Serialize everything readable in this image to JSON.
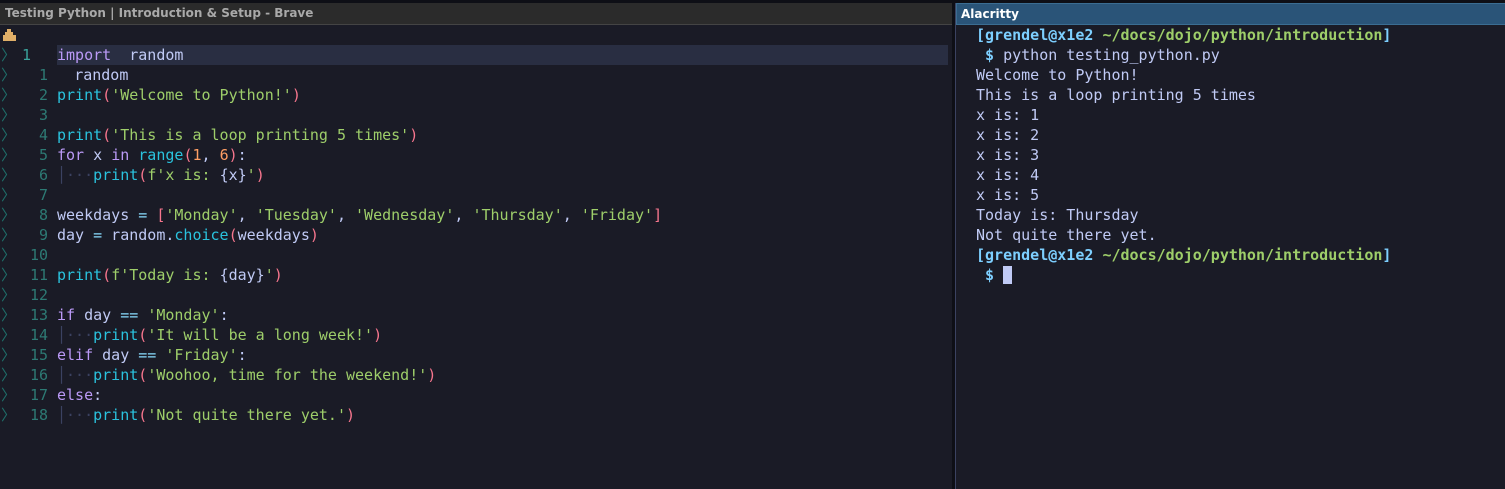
{
  "browser": {
    "title": "Testing Python | Introduction & Setup - Brave"
  },
  "editor": {
    "header": "random",
    "lines": [
      {
        "num": "1",
        "current": true,
        "tokens": [
          [
            "kw",
            "import"
          ],
          [
            "",
            "  "
          ],
          [
            "",
            "random"
          ]
        ]
      },
      {
        "num": "1",
        "tokens": []
      },
      {
        "num": "2",
        "tokens": [
          [
            "fn",
            "print"
          ],
          [
            "par",
            "("
          ],
          [
            "str",
            "'Welcome to Python!'"
          ],
          [
            "par",
            ")"
          ]
        ]
      },
      {
        "num": "3",
        "tokens": []
      },
      {
        "num": "4",
        "tokens": [
          [
            "fn",
            "print"
          ],
          [
            "par",
            "("
          ],
          [
            "str",
            "'This is a loop printing 5 times'"
          ],
          [
            "par",
            ")"
          ]
        ]
      },
      {
        "num": "5",
        "tokens": [
          [
            "kw",
            "for"
          ],
          [
            "",
            " x "
          ],
          [
            "kw",
            "in"
          ],
          [
            "",
            " "
          ],
          [
            "fn",
            "range"
          ],
          [
            "par",
            "("
          ],
          [
            "num",
            "1"
          ],
          [
            "",
            ", "
          ],
          [
            "num",
            "6"
          ],
          [
            "par",
            ")"
          ],
          [
            "",
            ":"
          ]
        ]
      },
      {
        "num": "6",
        "tokens": [
          [
            "guide",
            "│···"
          ],
          [
            "fn",
            "print"
          ],
          [
            "par",
            "("
          ],
          [
            "str",
            "f'x is: "
          ],
          [
            "",
            "{x}"
          ],
          [
            "str",
            "'"
          ],
          [
            "par",
            ")"
          ]
        ]
      },
      {
        "num": "7",
        "tokens": []
      },
      {
        "num": "8",
        "tokens": [
          [
            "",
            "weekdays "
          ],
          [
            "op",
            "="
          ],
          [
            "",
            " "
          ],
          [
            "par",
            "["
          ],
          [
            "str",
            "'Monday'"
          ],
          [
            "",
            ", "
          ],
          [
            "str",
            "'Tuesday'"
          ],
          [
            "",
            ", "
          ],
          [
            "str",
            "'Wednesday'"
          ],
          [
            "",
            ", "
          ],
          [
            "str",
            "'Thursday'"
          ],
          [
            "",
            ", "
          ],
          [
            "str",
            "'Friday'"
          ],
          [
            "par",
            "]"
          ]
        ]
      },
      {
        "num": "9",
        "tokens": [
          [
            "",
            "day "
          ],
          [
            "op",
            "="
          ],
          [
            "",
            " random."
          ],
          [
            "fn",
            "choice"
          ],
          [
            "par",
            "("
          ],
          [
            "",
            "weekdays"
          ],
          [
            "par",
            ")"
          ]
        ]
      },
      {
        "num": "10",
        "tokens": []
      },
      {
        "num": "11",
        "tokens": [
          [
            "fn",
            "print"
          ],
          [
            "par",
            "("
          ],
          [
            "str",
            "f'Today is: "
          ],
          [
            "",
            "{day}"
          ],
          [
            "str",
            "'"
          ],
          [
            "par",
            ")"
          ]
        ]
      },
      {
        "num": "12",
        "tokens": []
      },
      {
        "num": "13",
        "tokens": [
          [
            "kw",
            "if"
          ],
          [
            "",
            " day "
          ],
          [
            "op",
            "=="
          ],
          [
            "",
            " "
          ],
          [
            "str",
            "'Monday'"
          ],
          [
            "",
            ":"
          ]
        ]
      },
      {
        "num": "14",
        "tokens": [
          [
            "guide",
            "│···"
          ],
          [
            "fn",
            "print"
          ],
          [
            "par",
            "("
          ],
          [
            "str",
            "'It will be a long week!'"
          ],
          [
            "par",
            ")"
          ]
        ]
      },
      {
        "num": "15",
        "tokens": [
          [
            "kw",
            "elif"
          ],
          [
            "",
            " day "
          ],
          [
            "op",
            "=="
          ],
          [
            "",
            " "
          ],
          [
            "str",
            "'Friday'"
          ],
          [
            "",
            ":"
          ]
        ]
      },
      {
        "num": "16",
        "tokens": [
          [
            "guide",
            "│···"
          ],
          [
            "fn",
            "print"
          ],
          [
            "par",
            "("
          ],
          [
            "str",
            "'Woohoo, time for the weekend!'"
          ],
          [
            "par",
            ")"
          ]
        ]
      },
      {
        "num": "17",
        "tokens": [
          [
            "kw",
            "else"
          ],
          [
            "",
            ":"
          ]
        ]
      },
      {
        "num": "18",
        "tokens": [
          [
            "guide",
            "│···"
          ],
          [
            "fn",
            "print"
          ],
          [
            "par",
            "("
          ],
          [
            "str",
            "'Not quite there yet.'"
          ],
          [
            "par",
            ")"
          ]
        ]
      }
    ]
  },
  "terminal": {
    "title": "Alacritty",
    "prompt_user": "[grendel@x1e2 ",
    "prompt_path": "~/docs/dojo/python/introduction",
    "prompt_close": "]",
    "dollar": " $ ",
    "command": "python testing_python.py",
    "output": [
      "Welcome to Python!",
      "This is a loop printing 5 times",
      "x is: 1",
      "x is: 2",
      "x is: 3",
      "x is: 4",
      "x is: 5",
      "Today is: Thursday",
      "Not quite there yet."
    ]
  },
  "colors": {
    "background": "#1a1b26",
    "keyword": "#bb9af7",
    "function": "#2ac3de",
    "string": "#9ece6a",
    "bracket": "#f7768e",
    "number": "#ff9e64",
    "terminal_title": "#2a5478"
  }
}
